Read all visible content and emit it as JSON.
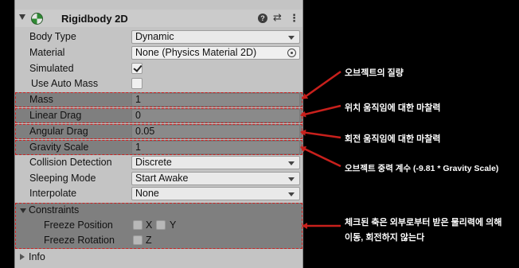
{
  "component": {
    "title": "Rigidbody 2D",
    "enabled": true,
    "help_icon": "help-icon",
    "preset_icon": "preset-icon",
    "more_icon": "more-icon",
    "help_glyph": "?",
    "preset_glyph": "⇄",
    "more_glyph": "⋮"
  },
  "properties": {
    "body_type": {
      "label": "Body Type",
      "value": "Dynamic"
    },
    "material": {
      "label": "Material",
      "value": "None (Physics Material 2D)"
    },
    "simulated": {
      "label": "Simulated",
      "checked": true
    },
    "use_auto_mass": {
      "label": "Use Auto Mass",
      "checked": false
    },
    "mass": {
      "label": "Mass",
      "value": "1"
    },
    "linear_drag": {
      "label": "Linear Drag",
      "value": "0"
    },
    "angular_drag": {
      "label": "Angular Drag",
      "value": "0.05"
    },
    "gravity_scale": {
      "label": "Gravity Scale",
      "value": "1"
    },
    "collision_detection": {
      "label": "Collision Detection",
      "value": "Discrete"
    },
    "sleeping_mode": {
      "label": "Sleeping Mode",
      "value": "Start Awake"
    },
    "interpolate": {
      "label": "Interpolate",
      "value": "None"
    }
  },
  "constraints": {
    "label": "Constraints",
    "freeze_position": {
      "label": "Freeze Position",
      "x": "X",
      "y": "Y"
    },
    "freeze_rotation": {
      "label": "Freeze Rotation",
      "z": "Z"
    }
  },
  "info": {
    "label": "Info"
  },
  "annotations": {
    "mass": "오브젝트의 질량",
    "linear_drag": "위치 움직임에 대한 마찰력",
    "angular_drag": "회전 움직임에 대한 마찰력",
    "gravity_scale": "오브젝트 중력 계수 (-9.81 * Gravity Scale)",
    "constraints_line1": "체크된 축은 외부로부터 받은 물리력에 의해",
    "constraints_line2": "이동, 회전하지 않는다"
  },
  "colors": {
    "annotation_arrow": "#c8201c",
    "highlight_bg": "#7f7f7f",
    "inspector_bg": "#c4c4c4"
  }
}
